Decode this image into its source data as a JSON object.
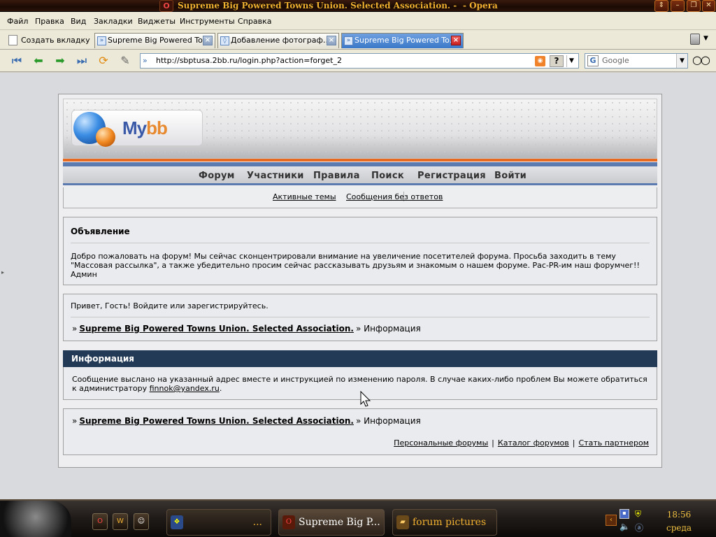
{
  "window": {
    "title": "Supreme Big Powered Towns Union. Selected Association. -",
    "app": "- Opera",
    "buttons": [
      "⇕",
      "–",
      "❐",
      "✕"
    ]
  },
  "menu": [
    "Файл",
    "Правка",
    "Вид",
    "Закладки",
    "Виджеты",
    "Инструменты",
    "Справка"
  ],
  "tabs": {
    "new_tab": "Создать вкладку",
    "items": [
      {
        "label": "Supreme Big Powered To…",
        "active": false
      },
      {
        "label": "Добавление фотограф…",
        "active": false
      },
      {
        "label": "Supreme Big Powered To…",
        "active": true
      }
    ]
  },
  "address": {
    "url": "http://sbptusa.2bb.ru/login.php?action=forget_2",
    "search_engine": "Google"
  },
  "forum": {
    "logo_a": "My",
    "logo_b": "bb",
    "nav": [
      "Форум",
      "Участники",
      "Правила",
      "Поиск",
      "Регистрация",
      "Войти"
    ],
    "subnav": [
      "Активные темы",
      "Сообщения без ответов"
    ],
    "announcement": {
      "title": "Объявление",
      "text": "Добро пожаловать на форум! Мы сейчас сконцентрировали внимание на увеличение посетителей форума. Просьба заходить в тему \"Массовая рассылка\", а также убедительно просим сейчас рассказывать друзьям и знакомым о нашем форуме. Рас-PR-им наш форумчег!!\nАдмин"
    },
    "greeting": "Привет, Гость!  Войдите или зарегистрируйтесь.",
    "crumb_sep": "»",
    "crumb_link": "Supreme Big Powered Towns Union. Selected Association.",
    "crumb_current": "» Информация",
    "info": {
      "title": "Информация",
      "text": "Сообщение выслано на указанный адрес вместе и инструкцией по изменению пароля. В случае каких-либо проблем Вы можете обратиться к администратору",
      "email": "finnok@yandex.ru",
      "end": "."
    },
    "footer_links": [
      "Персональные форумы",
      "Каталог форумов",
      "Стать партнером"
    ],
    "footer_sep": "|"
  },
  "taskbar": {
    "tasks": [
      {
        "label": "...",
        "active": false
      },
      {
        "label": "Supreme Big P...",
        "active": true
      },
      {
        "label": "forum pictures",
        "active": false
      }
    ],
    "time": "18:56",
    "day": "среда"
  },
  "colors": {
    "accent_orange": "#e86a20",
    "nav_blue": "#5a7ab0",
    "info_header": "#233a56"
  }
}
